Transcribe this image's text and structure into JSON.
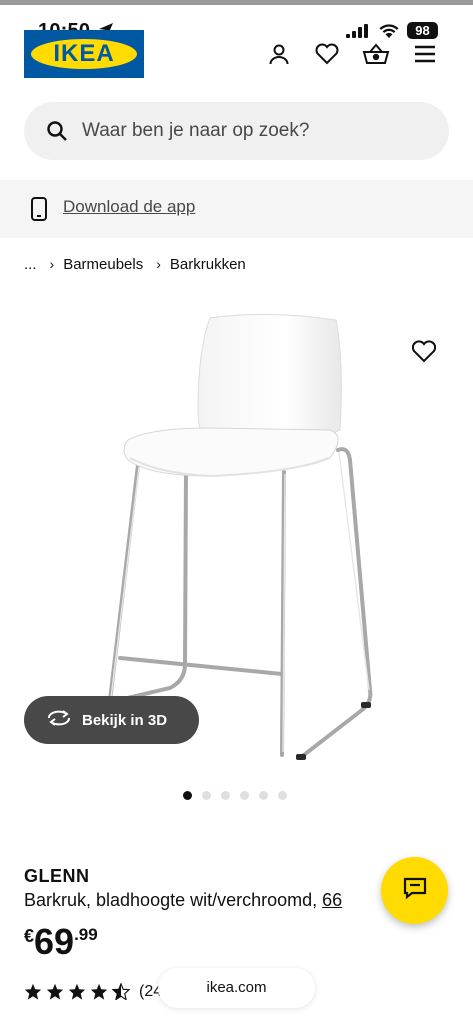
{
  "status_bar": {
    "time": "10:50",
    "battery": "98",
    "icons": [
      "location-arrow-icon",
      "signal-icon",
      "wifi-icon",
      "battery-icon"
    ]
  },
  "header": {
    "logo_text": "IKEA",
    "icons": [
      "profile-icon",
      "heart-icon",
      "basket-icon",
      "menu-icon"
    ]
  },
  "search": {
    "placeholder": "Waar ben je naar op zoek?"
  },
  "app_banner": {
    "label": "Download de app"
  },
  "breadcrumb": {
    "items": [
      "...",
      "Barmeubels",
      "Barkrukken"
    ]
  },
  "gallery": {
    "view_3d_label": "Bekijk in 3D",
    "dot_count": 6,
    "active_index": 0
  },
  "product": {
    "name": "GLENN",
    "description": "Barkruk, bladhoogte wit/verchroomd,",
    "description_link": "66",
    "price_currency": "€",
    "price_integer": "69",
    "price_decimal": ".99",
    "rating": 4.5,
    "rating_max": 5,
    "review_count": "(24"
  },
  "browser": {
    "url": "ikea.com"
  },
  "colors": {
    "ikea_blue": "#0058a3",
    "ikea_yellow": "#ffdb00",
    "dark_button": "#484848"
  }
}
